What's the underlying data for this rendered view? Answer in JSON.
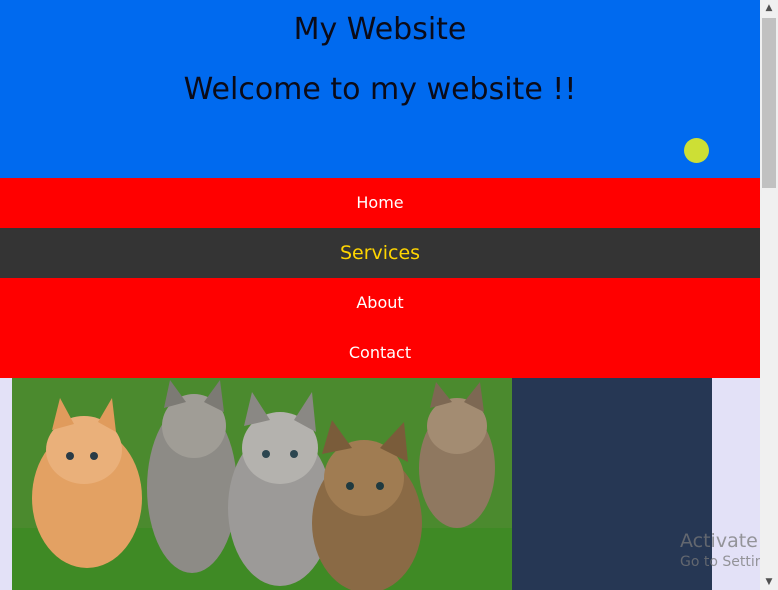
{
  "header": {
    "site_title": "My Website",
    "welcome_text": "Welcome to my website !!"
  },
  "nav": {
    "items": [
      {
        "label": "Home"
      },
      {
        "label": "Services"
      },
      {
        "label": "About"
      },
      {
        "label": "Contact"
      }
    ],
    "active": "Services"
  },
  "content": {
    "photo_icon": "kittens-photo"
  },
  "watermark": {
    "line1": "Activate Wi",
    "line2": "Go to Settings"
  },
  "colors": {
    "header_bg": "#006aef",
    "nav_bg": "#ff0000",
    "nav_active_bg": "#343434",
    "nav_active_text": "#ffd500",
    "dot": "#cddf35",
    "side_panel": "#263754",
    "page_bg": "#e3e1f7"
  }
}
